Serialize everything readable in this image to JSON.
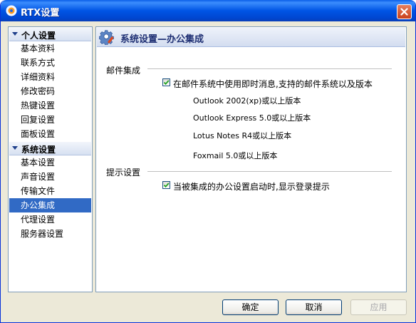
{
  "window": {
    "title": "RTX设置",
    "close_icon": "close-icon"
  },
  "sidebar": {
    "groups": [
      {
        "label": "个人设置",
        "items": [
          "基本资料",
          "联系方式",
          "详细资料",
          "修改密码",
          "热键设置",
          "回复设置",
          "面板设置"
        ]
      },
      {
        "label": "系统设置",
        "items": [
          "基本设置",
          "声音设置",
          "传输文件",
          "办公集成",
          "代理设置",
          "服务器设置"
        ]
      }
    ],
    "selected": "办公集成"
  },
  "page": {
    "title": "系统设置—办公集成",
    "mail_section": {
      "title": "邮件集成",
      "checkbox_label": "在邮件系统中使用即时消息,支持的邮件系统以及版本",
      "checked": true,
      "versions": [
        "Outlook 2002(xp)或以上版本",
        "Outlook Express 5.0或以上版本",
        "Lotus Notes R4或以上版本",
        "Foxmail 5.0或以上版本"
      ]
    },
    "prompt_section": {
      "title": "提示设置",
      "checkbox_label": "当被集成的办公设置启动时,显示登录提示",
      "checked": true
    }
  },
  "buttons": {
    "ok": "确定",
    "cancel": "取消",
    "apply": "应用"
  },
  "colors": {
    "titlebar": "#0055e5",
    "selection": "#316ac5",
    "frame_border": "#7f9db9",
    "window_bg": "#ece9d8"
  }
}
